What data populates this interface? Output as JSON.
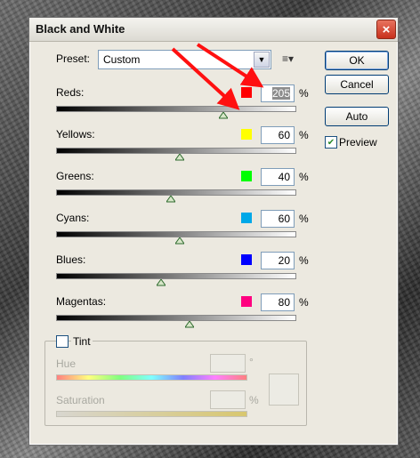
{
  "window": {
    "title": "Black and White",
    "close_label": "×"
  },
  "preset": {
    "label": "Preset:",
    "value": "Custom",
    "menu_icon": "list-options-icon"
  },
  "buttons": {
    "ok": "OK",
    "cancel": "Cancel",
    "auto": "Auto"
  },
  "preview": {
    "label": "Preview",
    "checked": true
  },
  "sliders": [
    {
      "label": "Reds:",
      "value": "205",
      "unit": "%",
      "color": "#ff0000",
      "level": 0.7
    },
    {
      "label": "Yellows:",
      "value": "60",
      "unit": "%",
      "color": "#ffff00",
      "level": 0.52
    },
    {
      "label": "Greens:",
      "value": "40",
      "unit": "%",
      "color": "#00ff00",
      "level": 0.48
    },
    {
      "label": "Cyans:",
      "value": "60",
      "unit": "%",
      "color": "#00a8e8",
      "level": 0.52
    },
    {
      "label": "Blues:",
      "value": "20",
      "unit": "%",
      "color": "#0000ff",
      "level": 0.44
    },
    {
      "label": "Magentas:",
      "value": "80",
      "unit": "%",
      "color": "#ff0080",
      "level": 0.56
    }
  ],
  "tint": {
    "label": "Tint",
    "checked": false,
    "hue_label": "Hue",
    "hue_unit": "°",
    "saturation_label": "Saturation",
    "saturation_unit": "%"
  },
  "annotation_color": "#ff1010"
}
